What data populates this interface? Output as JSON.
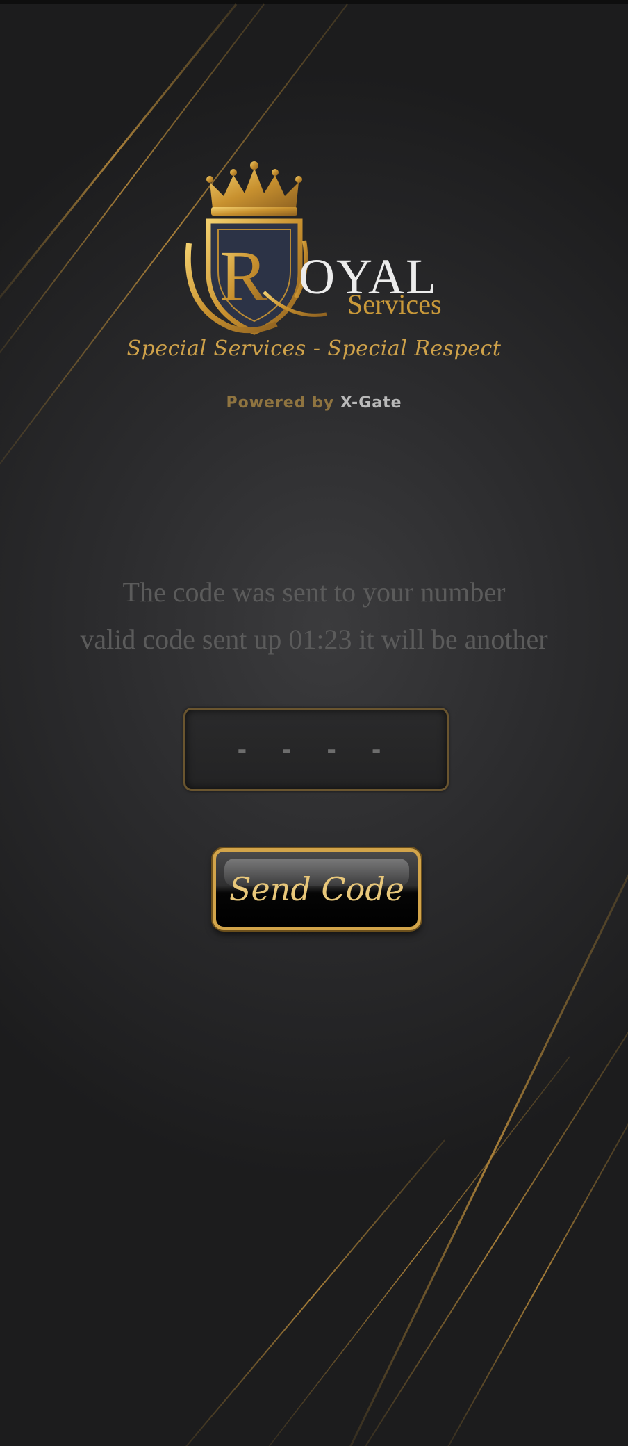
{
  "brand": {
    "logo_letter": "R",
    "logo_word": "OYAL",
    "logo_sub": "Services",
    "tagline": "Special Services - Special Respect"
  },
  "powered": {
    "prefix": "Powered by",
    "name": "X-Gate"
  },
  "message": {
    "line1": "The code was sent to your number",
    "line2": "valid code sent up 01:23 it will be another"
  },
  "code_input": {
    "placeholder": "- - - -",
    "value": ""
  },
  "send_button": {
    "label": "Send Code"
  },
  "colors": {
    "gold": "#d2a44a",
    "background": "#2c2c2e",
    "message_text": "#5b5b5b"
  }
}
